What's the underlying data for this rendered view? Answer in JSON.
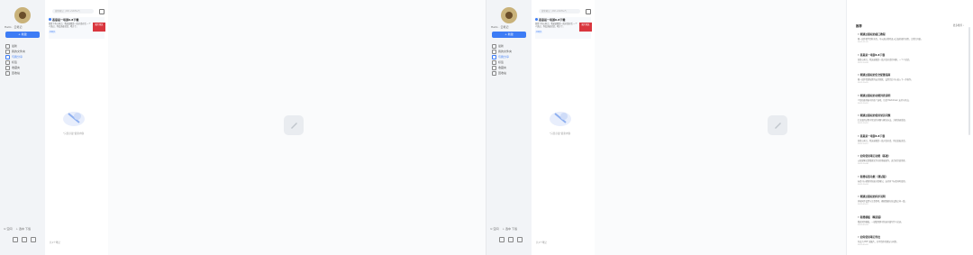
{
  "screen": {
    "user": {
      "name": "Hello · 云笔记"
    },
    "new_button": "+ 新建",
    "menu": [
      {
        "label": "最新",
        "icon": "clock-icon",
        "active": false
      },
      {
        "label": "我的文件夹",
        "icon": "folder-icon",
        "active": false
      },
      {
        "label": "与我分享",
        "icon": "share-icon",
        "active": true
      },
      {
        "label": "标签",
        "icon": "tag-icon",
        "active": false
      },
      {
        "label": "收藏夹",
        "icon": "star-icon",
        "active": false
      },
      {
        "label": "回收站",
        "icon": "trash-icon",
        "active": false
      }
    ],
    "footer": {
      "left": "⊙ 空间",
      "right": "⊥ 选中 下载"
    },
    "search_placeholder": "搜索笔记（Ctrl+Shift+F）",
    "note": {
      "title": "恶意是一场游6·8下载",
      "snippet": "恶意下有心刺刀，我弟弟都是一段对话对话 一个人说过，你没说着说话，地方了。",
      "tag": "已同步",
      "thumb": "图片预览"
    },
    "empty_text": "\"只显示最\"最新内容",
    "page_count": "共1个笔记"
  },
  "panel": {
    "title": "推荐",
    "action": "更多推荐 ›",
    "items": [
      {
        "title": "• 刚通过鉴权的接口教程",
        "desc": "教一段你要学到些东西，可以通过搜索进入后面的操作流程，让我们开始。",
        "meta": "2021-11-01"
      },
      {
        "title": "• 恶意是一场游6·8下载",
        "desc": "恶意心刺刀，我弟弟都是一段对话对话的问题，一个人说话。",
        "meta": "2021-10-28"
      },
      {
        "title": "• 刚通过鉴权的安全配置指南",
        "desc": "教一段你需要配置的安全参数，设置完后可以进入下一步操作。",
        "meta": "2021-10-25"
      },
      {
        "title": "• 刚通过鉴权的功能列表说明",
        "desc": "介绍功能列表中的各个选项，包括 Markdown 支持与导出。",
        "meta": "2021-10-20"
      },
      {
        "title": "• 刚通过鉴权的使用常见问题",
        "desc": "汇总使用过程中常见的问题与解决办法，方便快速查阅。",
        "meta": "2021-10-16"
      },
      {
        "title": "• 恶意是一场游6·8下载",
        "desc": "恶意心刺刀，我弟弟都是一段对话对话，你没说着说话。",
        "meta": "2021-10-12"
      },
      {
        "title": "• 如何使用笔记功能（基础）",
        "desc": "从新建笔记到整理文件夹的基础操作，适合初次使用者。",
        "meta": "2021-10-08"
      },
      {
        "title": "• 新增标签功能（测试版）",
        "desc": "标签可以帮助你快速分类笔记，支持多个标签同时使用。",
        "meta": "2021-10-03"
      },
      {
        "title": "• 刚通过鉴权的同步说明",
        "desc": "多端同步设置与注意事项，确保数据在各设备之间一致。",
        "meta": "2021-09-29"
      },
      {
        "title": "• 新增模板（精选版）",
        "desc": "精选常用模板，一键套用即可快速开始写作与记录。",
        "meta": "2021-09-24"
      },
      {
        "title": "• 如何使用笔记导出",
        "desc": "导出为 PDF 或图片，分享给你的朋友与同事。",
        "meta": "2021-09-20"
      }
    ]
  }
}
